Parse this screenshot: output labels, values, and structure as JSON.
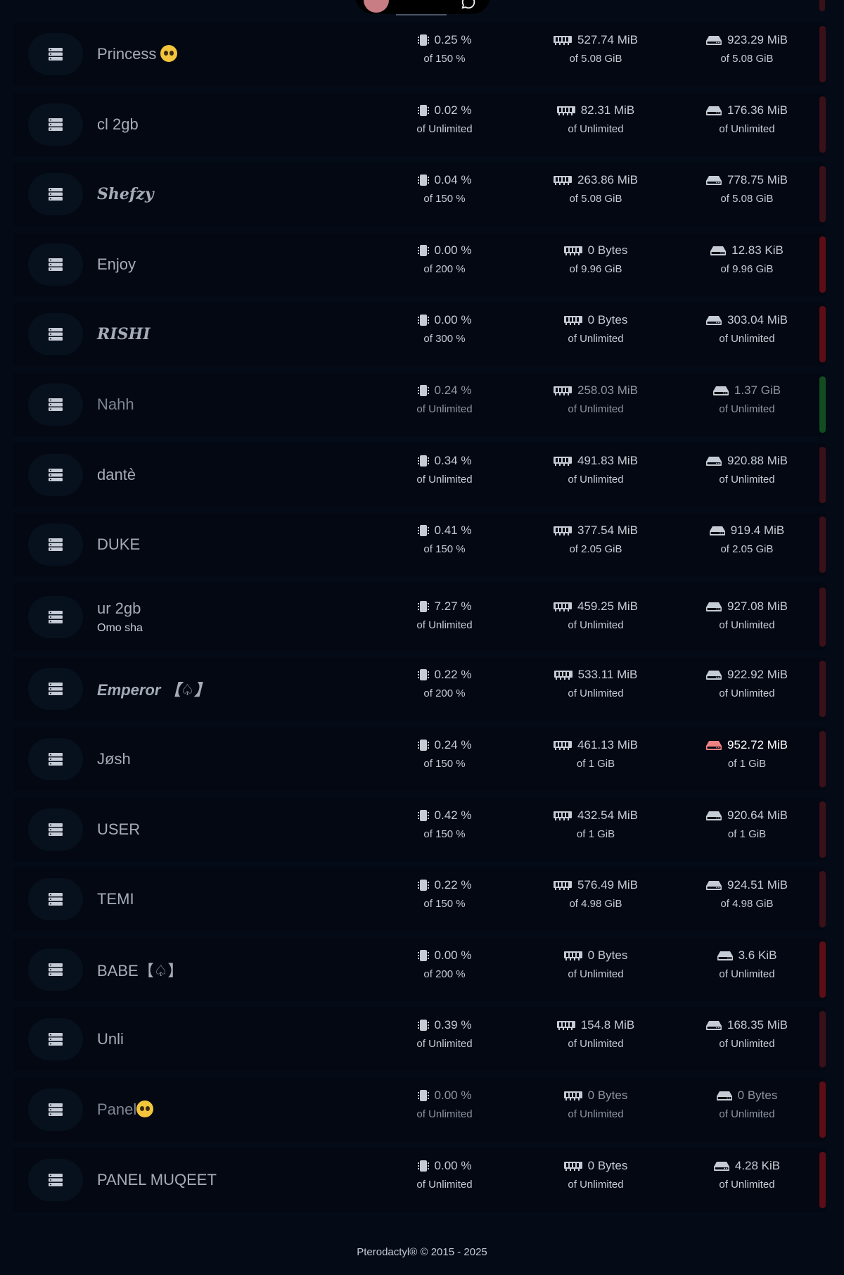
{
  "footer": {
    "text": "Pterodactyl® © 2015 - 2025"
  },
  "icons": {
    "server": "server-icon",
    "cpu": "cpu-icon",
    "memory": "memory-icon",
    "disk": "disk-icon",
    "chat": "chat-icon"
  },
  "colors": {
    "status_offline": "#5c0d15",
    "status_running": "#114d20",
    "status_unknown": "#3a1118",
    "disk_alert": "#f08282"
  },
  "servers": [
    {
      "name": "Princess",
      "emoji": true,
      "cpu": "0.25 %",
      "cpu_limit": "of 150 %",
      "memory": "527.74 MiB",
      "memory_limit": "of 5.08 GiB",
      "disk": "923.29 MiB",
      "disk_limit": "of 5.08 GiB",
      "status": "unknown"
    },
    {
      "name": "cl 2gb",
      "cpu": "0.02 %",
      "cpu_limit": "of Unlimited",
      "memory": "82.31 MiB",
      "memory_limit": "of Unlimited",
      "disk": "176.36 MiB",
      "disk_limit": "of Unlimited",
      "status": "unknown"
    },
    {
      "name": "Shefzy",
      "style": "serif-bold",
      "cpu": "0.04 %",
      "cpu_limit": "of 150 %",
      "memory": "263.86 MiB",
      "memory_limit": "of 5.08 GiB",
      "disk": "778.75 MiB",
      "disk_limit": "of 5.08 GiB",
      "status": "unknown"
    },
    {
      "name": "Enjoy",
      "cpu": "0.00 %",
      "cpu_limit": "of 200 %",
      "memory": "0 Bytes",
      "memory_limit": "of 9.96 GiB",
      "disk": "12.83 KiB",
      "disk_limit": "of 9.96 GiB",
      "status": "offline"
    },
    {
      "name": "RISHI",
      "style": "serif-bold",
      "cpu": "0.00 %",
      "cpu_limit": "of 300 %",
      "memory": "0 Bytes",
      "memory_limit": "of Unlimited",
      "disk": "303.04 MiB",
      "disk_limit": "of Unlimited",
      "status": "offline"
    },
    {
      "name": "Nahh",
      "dim": true,
      "cpu": "0.24 %",
      "cpu_limit": "of Unlimited",
      "memory": "258.03 MiB",
      "memory_limit": "of Unlimited",
      "disk": "1.37 GiB",
      "disk_limit": "of Unlimited",
      "status": "running"
    },
    {
      "name": "dantè",
      "cpu": "0.34 %",
      "cpu_limit": "of Unlimited",
      "memory": "491.83 MiB",
      "memory_limit": "of Unlimited",
      "disk": "920.88 MiB",
      "disk_limit": "of Unlimited",
      "status": "unknown"
    },
    {
      "name": "DUKE",
      "cpu": "0.41 %",
      "cpu_limit": "of 150 %",
      "memory": "377.54 MiB",
      "memory_limit": "of 2.05 GiB",
      "disk": "919.4 MiB",
      "disk_limit": "of 2.05 GiB",
      "status": "unknown"
    },
    {
      "name": "ur 2gb",
      "description": "Omo sha",
      "cpu": "7.27 %",
      "cpu_limit": "of Unlimited",
      "memory": "459.25 MiB",
      "memory_limit": "of Unlimited",
      "disk": "927.08 MiB",
      "disk_limit": "of Unlimited",
      "status": "unknown"
    },
    {
      "name": "Emperor 【♤】",
      "style": "bold-italic",
      "cpu": "0.22 %",
      "cpu_limit": "of 200 %",
      "memory": "533.11 MiB",
      "memory_limit": "of Unlimited",
      "disk": "922.92 MiB",
      "disk_limit": "of Unlimited",
      "status": "unknown"
    },
    {
      "name": "Jøsh",
      "cpu": "0.24 %",
      "cpu_limit": "of 150 %",
      "memory": "461.13 MiB",
      "memory_limit": "of 1 GiB",
      "disk": "952.72 MiB",
      "disk_limit": "of 1 GiB",
      "disk_alert": true,
      "status": "unknown"
    },
    {
      "name": "USER",
      "cpu": "0.42 %",
      "cpu_limit": "of 150 %",
      "memory": "432.54 MiB",
      "memory_limit": "of 1 GiB",
      "disk": "920.64 MiB",
      "disk_limit": "of 1 GiB",
      "status": "unknown"
    },
    {
      "name": "TEMI",
      "cpu": "0.22 %",
      "cpu_limit": "of 150 %",
      "memory": "576.49 MiB",
      "memory_limit": "of 4.98 GiB",
      "disk": "924.51 MiB",
      "disk_limit": "of 4.98 GiB",
      "status": "unknown"
    },
    {
      "name": "BABE【♤】",
      "cpu": "0.00 %",
      "cpu_limit": "of 200 %",
      "memory": "0 Bytes",
      "memory_limit": "of Unlimited",
      "disk": "3.6 KiB",
      "disk_limit": "of Unlimited",
      "status": "offline"
    },
    {
      "name": "Unli",
      "cpu": "0.39 %",
      "cpu_limit": "of Unlimited",
      "memory": "154.8 MiB",
      "memory_limit": "of Unlimited",
      "disk": "168.35 MiB",
      "disk_limit": "of Unlimited",
      "status": "unknown"
    },
    {
      "name": "Panel",
      "emoji": true,
      "dim": true,
      "cpu": "0.00 %",
      "cpu_limit": "of Unlimited",
      "memory": "0 Bytes",
      "memory_limit": "of Unlimited",
      "disk": "0 Bytes",
      "disk_limit": "of Unlimited",
      "status": "offline"
    },
    {
      "name": "PANEL MUQEET",
      "cpu": "0.00 %",
      "cpu_limit": "of Unlimited",
      "memory": "0 Bytes",
      "memory_limit": "of Unlimited",
      "disk": "4.28 KiB",
      "disk_limit": "of Unlimited",
      "status": "offline"
    }
  ]
}
